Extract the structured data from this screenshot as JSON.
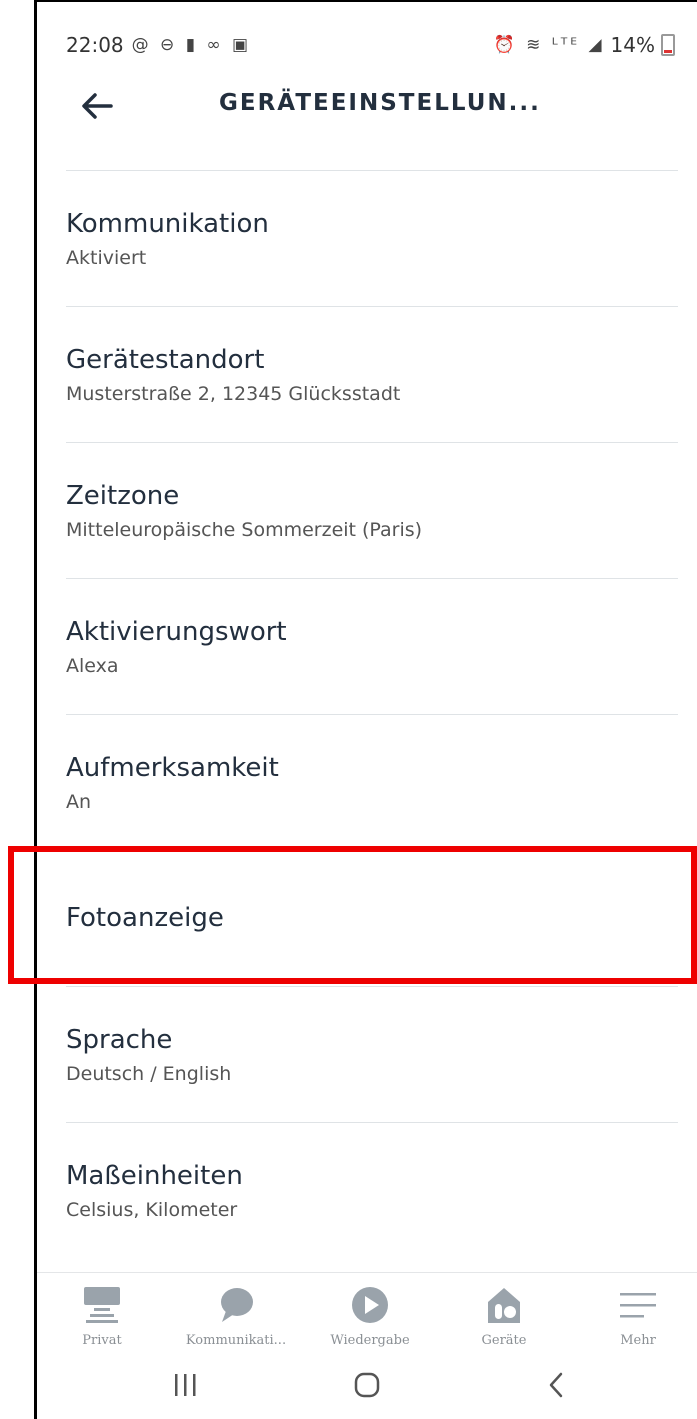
{
  "status_bar": {
    "time": "22:08",
    "left_icons": "@ ⊖ ▮ ∞ ▣",
    "right_icons": "⏰ ≋ ᴸᵀᴱ ◢",
    "battery": "14%"
  },
  "header": {
    "title": "GERÄTEEINSTELLUN..."
  },
  "settings": [
    {
      "label": "Kommunikation",
      "sub": "Aktiviert"
    },
    {
      "label": "Gerätestandort",
      "sub": "Musterstraße 2, 12345 Glücksstadt"
    },
    {
      "label": "Zeitzone",
      "sub": "Mitteleuropäische Sommerzeit (Paris)"
    },
    {
      "label": "Aktivierungswort",
      "sub": "Alexa"
    },
    {
      "label": "Aufmerksamkeit",
      "sub": "An"
    },
    {
      "label": "Fotoanzeige",
      "sub": ""
    },
    {
      "label": "Sprache",
      "sub": "Deutsch / English"
    },
    {
      "label": "Maßeinheiten",
      "sub": "Celsius, Kilometer"
    }
  ],
  "tabs": [
    {
      "label": "Privat",
      "icon": "home-icon"
    },
    {
      "label": "Kommunikati...",
      "icon": "chat-bubble-icon"
    },
    {
      "label": "Wiedergabe",
      "icon": "play-icon"
    },
    {
      "label": "Geräte",
      "icon": "devices-icon"
    },
    {
      "label": "Mehr",
      "icon": "menu-icon"
    }
  ],
  "colors": {
    "highlight": "#ee0000",
    "text": "#232f3e",
    "tab_icon": "#9aa3ab"
  }
}
